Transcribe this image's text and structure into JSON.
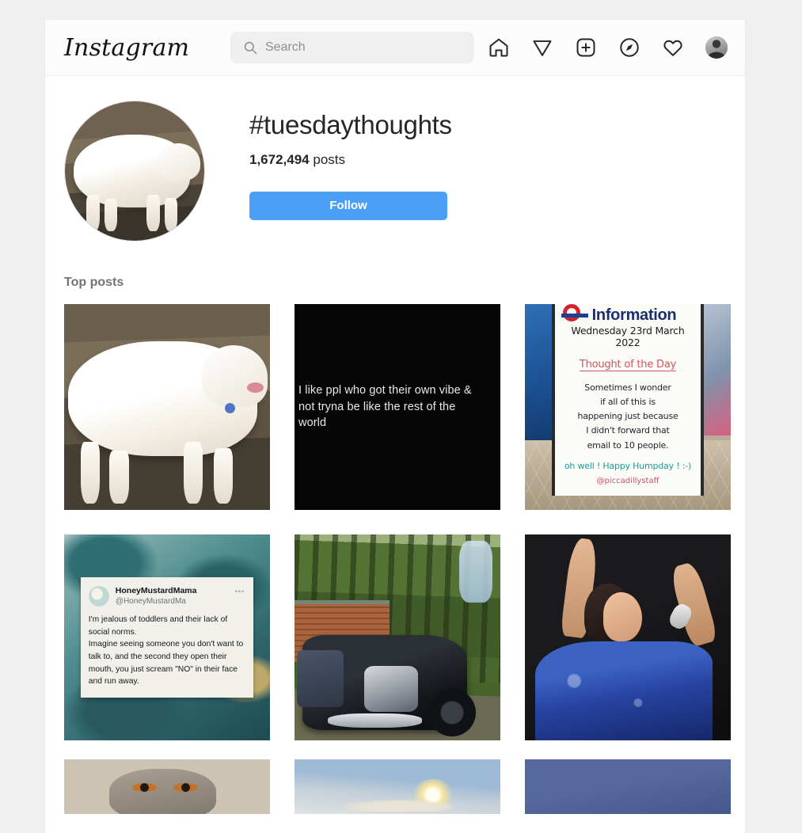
{
  "app": {
    "brand": "Instagram"
  },
  "header": {
    "search_placeholder": "Search",
    "search_value": "",
    "icons": [
      {
        "name": "home-icon",
        "label": "Home"
      },
      {
        "name": "paper-plane-icon",
        "label": "Messages"
      },
      {
        "name": "plus-square-icon",
        "label": "New post"
      },
      {
        "name": "compass-icon",
        "label": "Explore"
      },
      {
        "name": "heart-icon",
        "label": "Activity"
      }
    ],
    "avatar_label": "Profile"
  },
  "profile": {
    "hashtag": "#tuesdaythoughts",
    "post_count": "1,672,494",
    "post_count_suffix": "posts",
    "follow_label": "Follow",
    "follow_color": "#4a9ef5",
    "avatar_alt": "White Great Pyrenees dog standing on dirt"
  },
  "grid": {
    "section_label": "Top posts",
    "posts": [
      {
        "id": "post-dog",
        "alt": "White Great Pyrenees dog standing in profile on brown dirt"
      },
      {
        "id": "post-quote",
        "alt": "Black background quote card",
        "quote": "I like ppl who got their own vibe & not tryna be like the rest of the world"
      },
      {
        "id": "post-whiteboard",
        "alt": "London Underground station information whiteboard",
        "board": {
          "title": "Information",
          "date": "Wednesday 23rd March 2022",
          "heading": "Thought of the Day",
          "body": "Sometimes I wonder\nif all of this is\nhappening just because\nI didn't forward that\nemail to 10 people.",
          "signoff": "oh well ! Happy Humpday ! :-)",
          "handle": "@piccadillystaff"
        }
      },
      {
        "id": "post-tweet",
        "alt": "Tweet screenshot over teal marble background",
        "tweet": {
          "name": "HoneyMustardMama",
          "handle": "@HoneyMustardMa",
          "menu": "•••",
          "text": "I'm jealous of toddlers and their lack of social norms.\nImagine seeing someone you don't want to talk to, and the second they open their mouth, you just scream \"NO\" in their face and run away."
        }
      },
      {
        "id": "post-motorcycle",
        "alt": "Black Indian motorcycle with leather saddlebags parked by a woodpile in a forest"
      },
      {
        "id": "post-singer",
        "alt": "Singer in blue sequined dress performing with microphone, arm raised"
      },
      {
        "id": "post-cat",
        "alt": "Tabby cat face against a textured wall"
      },
      {
        "id": "post-sun",
        "alt": "Bright sun glowing through clouds in a pale blue sky"
      },
      {
        "id": "post-blue",
        "alt": "Solid blue-gray image"
      }
    ]
  }
}
